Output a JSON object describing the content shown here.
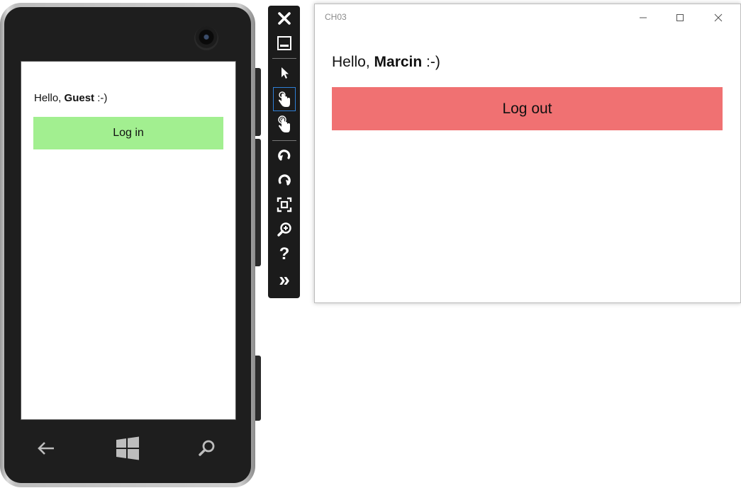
{
  "phone": {
    "greeting_prefix": "Hello, ",
    "user_name": "Guest",
    "greeting_suffix": " :-)",
    "button_label": "Log in",
    "button_color": "#a2ef90"
  },
  "toolbar": {
    "items": [
      {
        "icon": "close-icon"
      },
      {
        "icon": "minimize-icon"
      },
      {
        "icon": "pointer-icon"
      },
      {
        "icon": "single-touch-icon"
      },
      {
        "icon": "pinch-zoom-icon"
      },
      {
        "icon": "rotate-left-icon"
      },
      {
        "icon": "rotate-right-icon"
      },
      {
        "icon": "fit-to-screen-icon"
      },
      {
        "icon": "zoom-icon"
      },
      {
        "icon": "help-icon"
      },
      {
        "icon": "additional-tools-icon"
      }
    ],
    "help_glyph": "?",
    "more_glyph": "»"
  },
  "window": {
    "title": "CH03",
    "greeting_prefix": "Hello, ",
    "user_name": "Marcin",
    "greeting_suffix": " :-)",
    "button_label": "Log out",
    "button_color": "#f07172"
  }
}
